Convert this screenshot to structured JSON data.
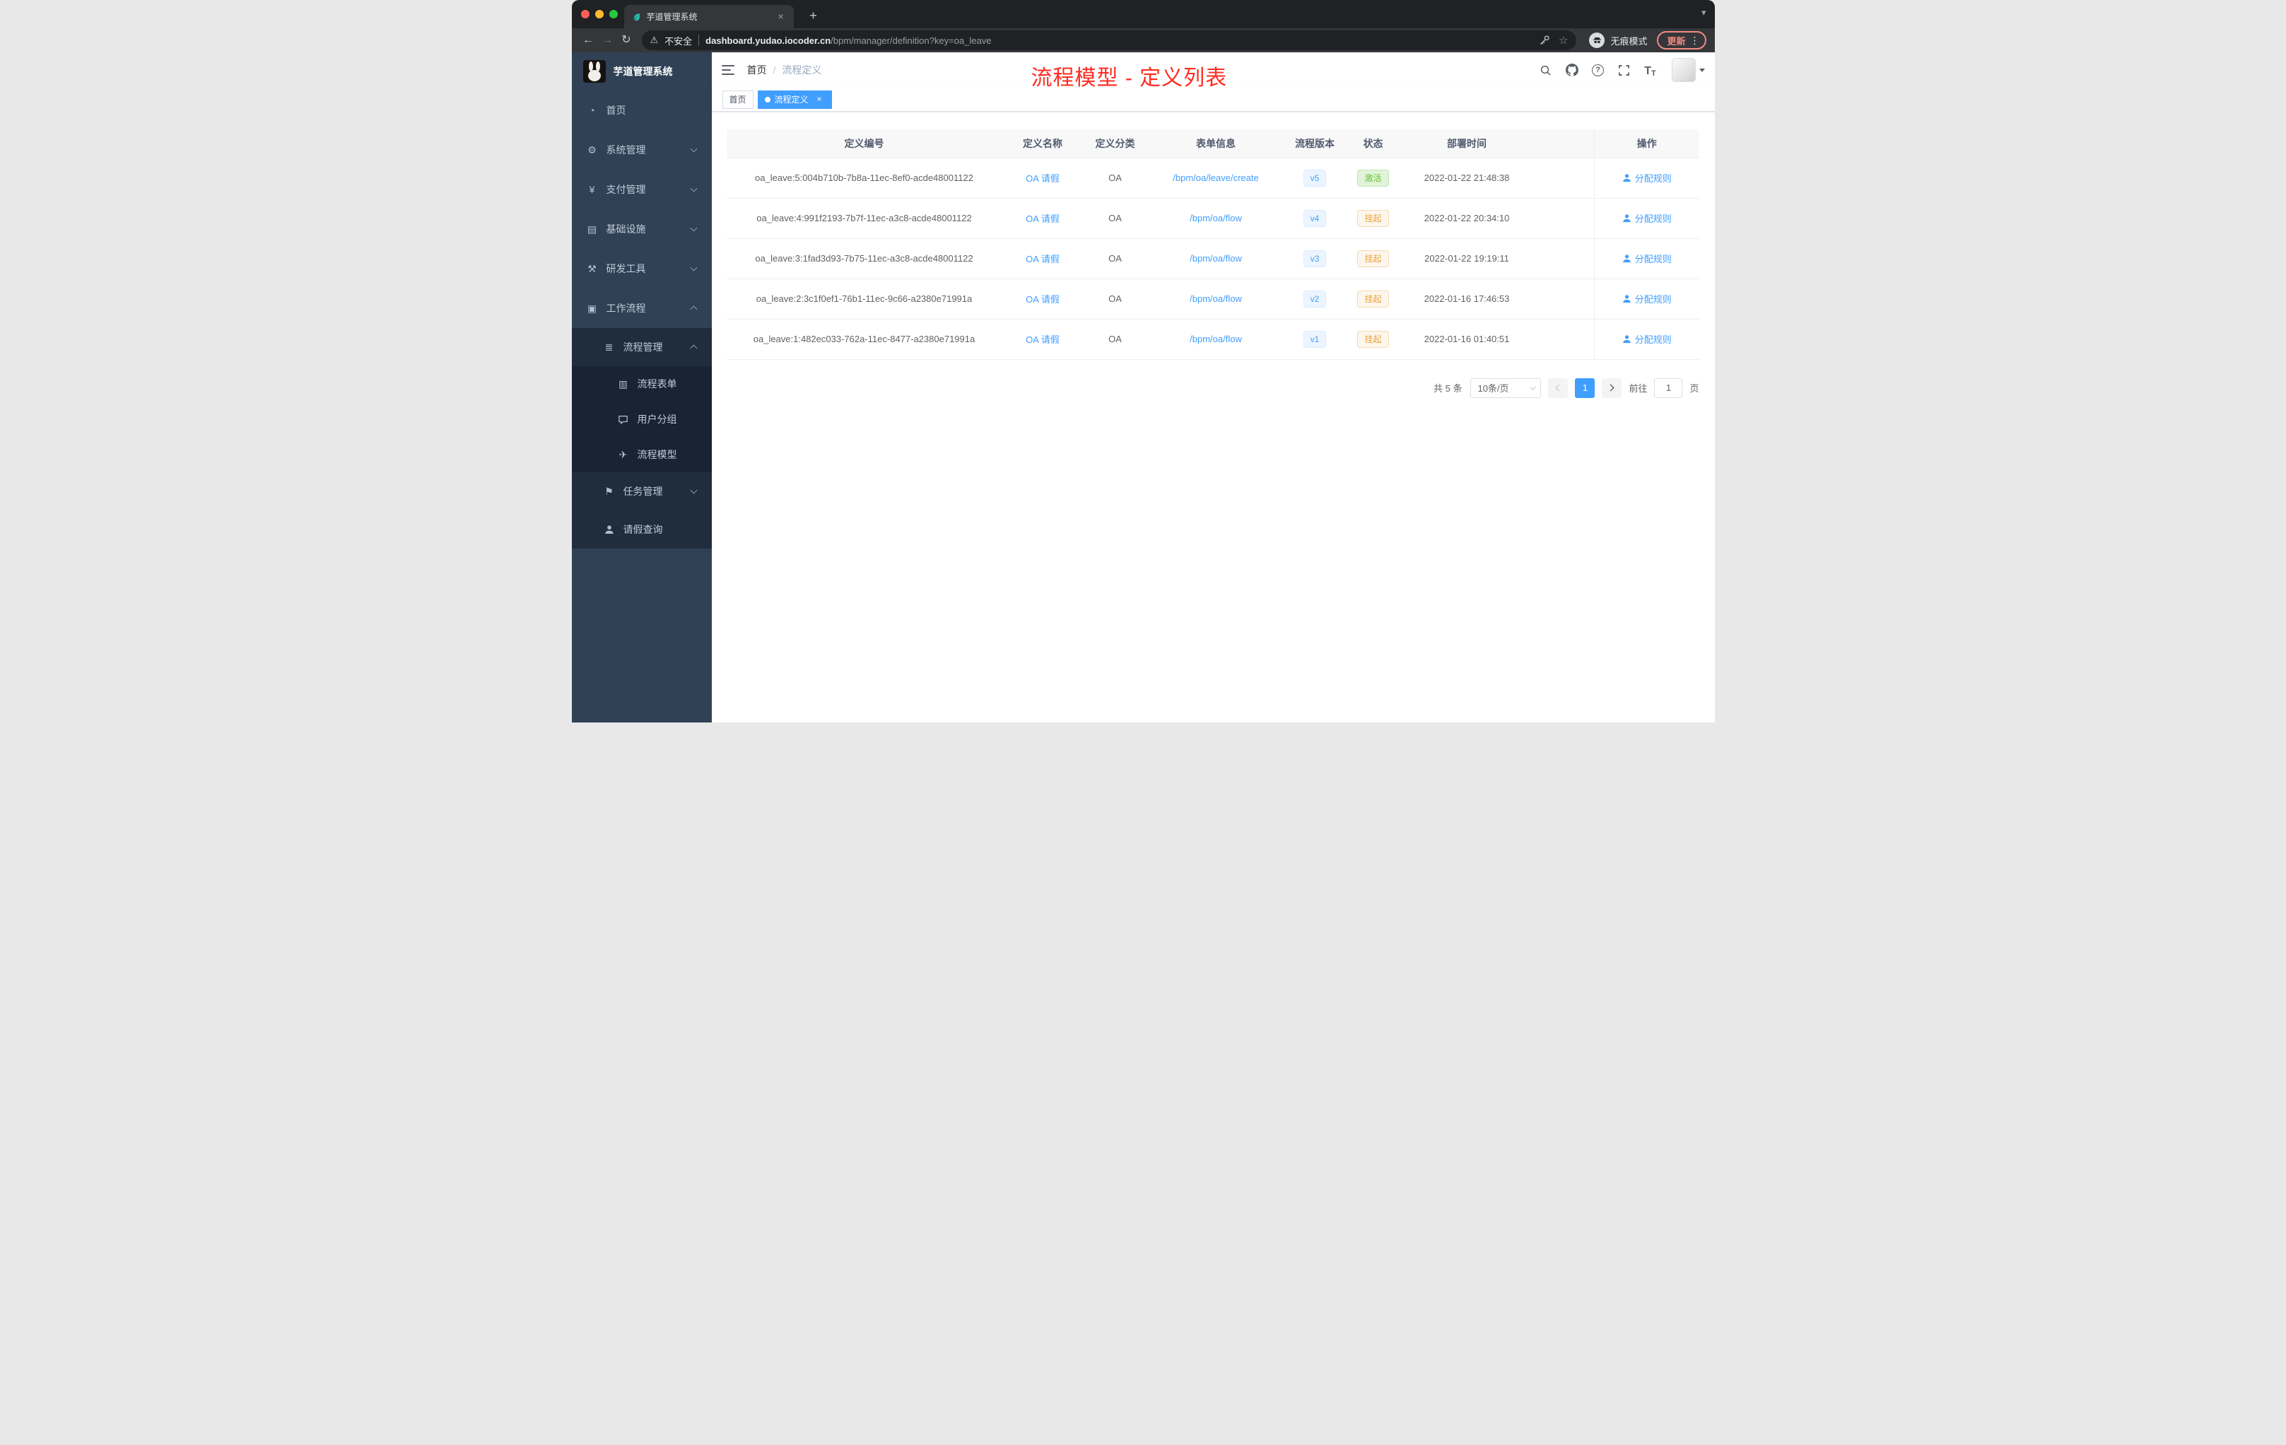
{
  "browser": {
    "tab_title": "芋道管理系统",
    "security_label": "不安全",
    "url_domain": "dashboard.yudao.iocoder.cn",
    "url_path": "/bpm/manager/definition?key=oa_leave",
    "incognito_label": "无痕模式",
    "update_label": "更新"
  },
  "sidebar": {
    "logo_title": "芋道管理系统",
    "items": [
      {
        "label": "首页"
      },
      {
        "label": "系统管理"
      },
      {
        "label": "支付管理"
      },
      {
        "label": "基础设施"
      },
      {
        "label": "研发工具"
      },
      {
        "label": "工作流程"
      },
      {
        "label": "流程管理"
      },
      {
        "label": "流程表单"
      },
      {
        "label": "用户分组"
      },
      {
        "label": "流程模型"
      },
      {
        "label": "任务管理"
      },
      {
        "label": "请假查询"
      }
    ]
  },
  "navbar": {
    "breadcrumb_home": "首页",
    "breadcrumb_separator": "/",
    "breadcrumb_current": "流程定义"
  },
  "annotation": "流程模型 - 定义列表",
  "tags": {
    "home_label": "首页",
    "active_label": "流程定义"
  },
  "table": {
    "columns": [
      "定义编号",
      "定义名称",
      "定义分类",
      "表单信息",
      "流程版本",
      "状态",
      "部署时间",
      "操作"
    ],
    "rows": [
      {
        "id": "oa_leave:5:004b710b-7b8a-11ec-8ef0-acde48001122",
        "name": "OA 请假",
        "category": "OA",
        "form": "/bpm/oa/leave/create",
        "version": "v5",
        "status": "激活",
        "status_type": "success",
        "deploy_time": "2022-01-22 21:48:38",
        "action": "分配规则"
      },
      {
        "id": "oa_leave:4:991f2193-7b7f-11ec-a3c8-acde48001122",
        "name": "OA 请假",
        "category": "OA",
        "form": "/bpm/oa/flow",
        "version": "v4",
        "status": "挂起",
        "status_type": "warning",
        "deploy_time": "2022-01-22 20:34:10",
        "action": "分配规则"
      },
      {
        "id": "oa_leave:3:1fad3d93-7b75-11ec-a3c8-acde48001122",
        "name": "OA 请假",
        "category": "OA",
        "form": "/bpm/oa/flow",
        "version": "v3",
        "status": "挂起",
        "status_type": "warning",
        "deploy_time": "2022-01-22 19:19:11",
        "action": "分配规则"
      },
      {
        "id": "oa_leave:2:3c1f0ef1-76b1-11ec-9c66-a2380e71991a",
        "name": "OA 请假",
        "category": "OA",
        "form": "/bpm/oa/flow",
        "version": "v2",
        "status": "挂起",
        "status_type": "warning",
        "deploy_time": "2022-01-16 17:46:53",
        "action": "分配规则"
      },
      {
        "id": "oa_leave:1:482ec033-762a-11ec-8477-a2380e71991a",
        "name": "OA 请假",
        "category": "OA",
        "form": "/bpm/oa/flow",
        "version": "v1",
        "status": "挂起",
        "status_type": "warning",
        "deploy_time": "2022-01-16 01:40:51",
        "action": "分配规则"
      }
    ]
  },
  "pagination": {
    "total_label": "共 5 条",
    "page_size_label": "10条/页",
    "current_page": "1",
    "goto_label": "前往",
    "goto_value": "1",
    "page_unit": "页"
  },
  "colors": {
    "accent": "#409eff",
    "annotation": "#fe2b20",
    "status_active": "#67c23a",
    "status_suspended": "#e6a23c"
  },
  "icons": {
    "back": "←",
    "forward": "→",
    "reload": "↻",
    "warning": "⚠",
    "star": "☆",
    "kebab": "⋮",
    "close": "×",
    "plus": "+",
    "caret": "▾",
    "dashboard": "◔",
    "gear": "⚙",
    "yen": "¥",
    "infrastructure": "▤",
    "tools": "⚒",
    "workflow": "▣",
    "list": "≣",
    "form": "▥",
    "plane": "✈",
    "flag": "⚑",
    "question": "?",
    "t_large": "T",
    "t_small": "T"
  }
}
